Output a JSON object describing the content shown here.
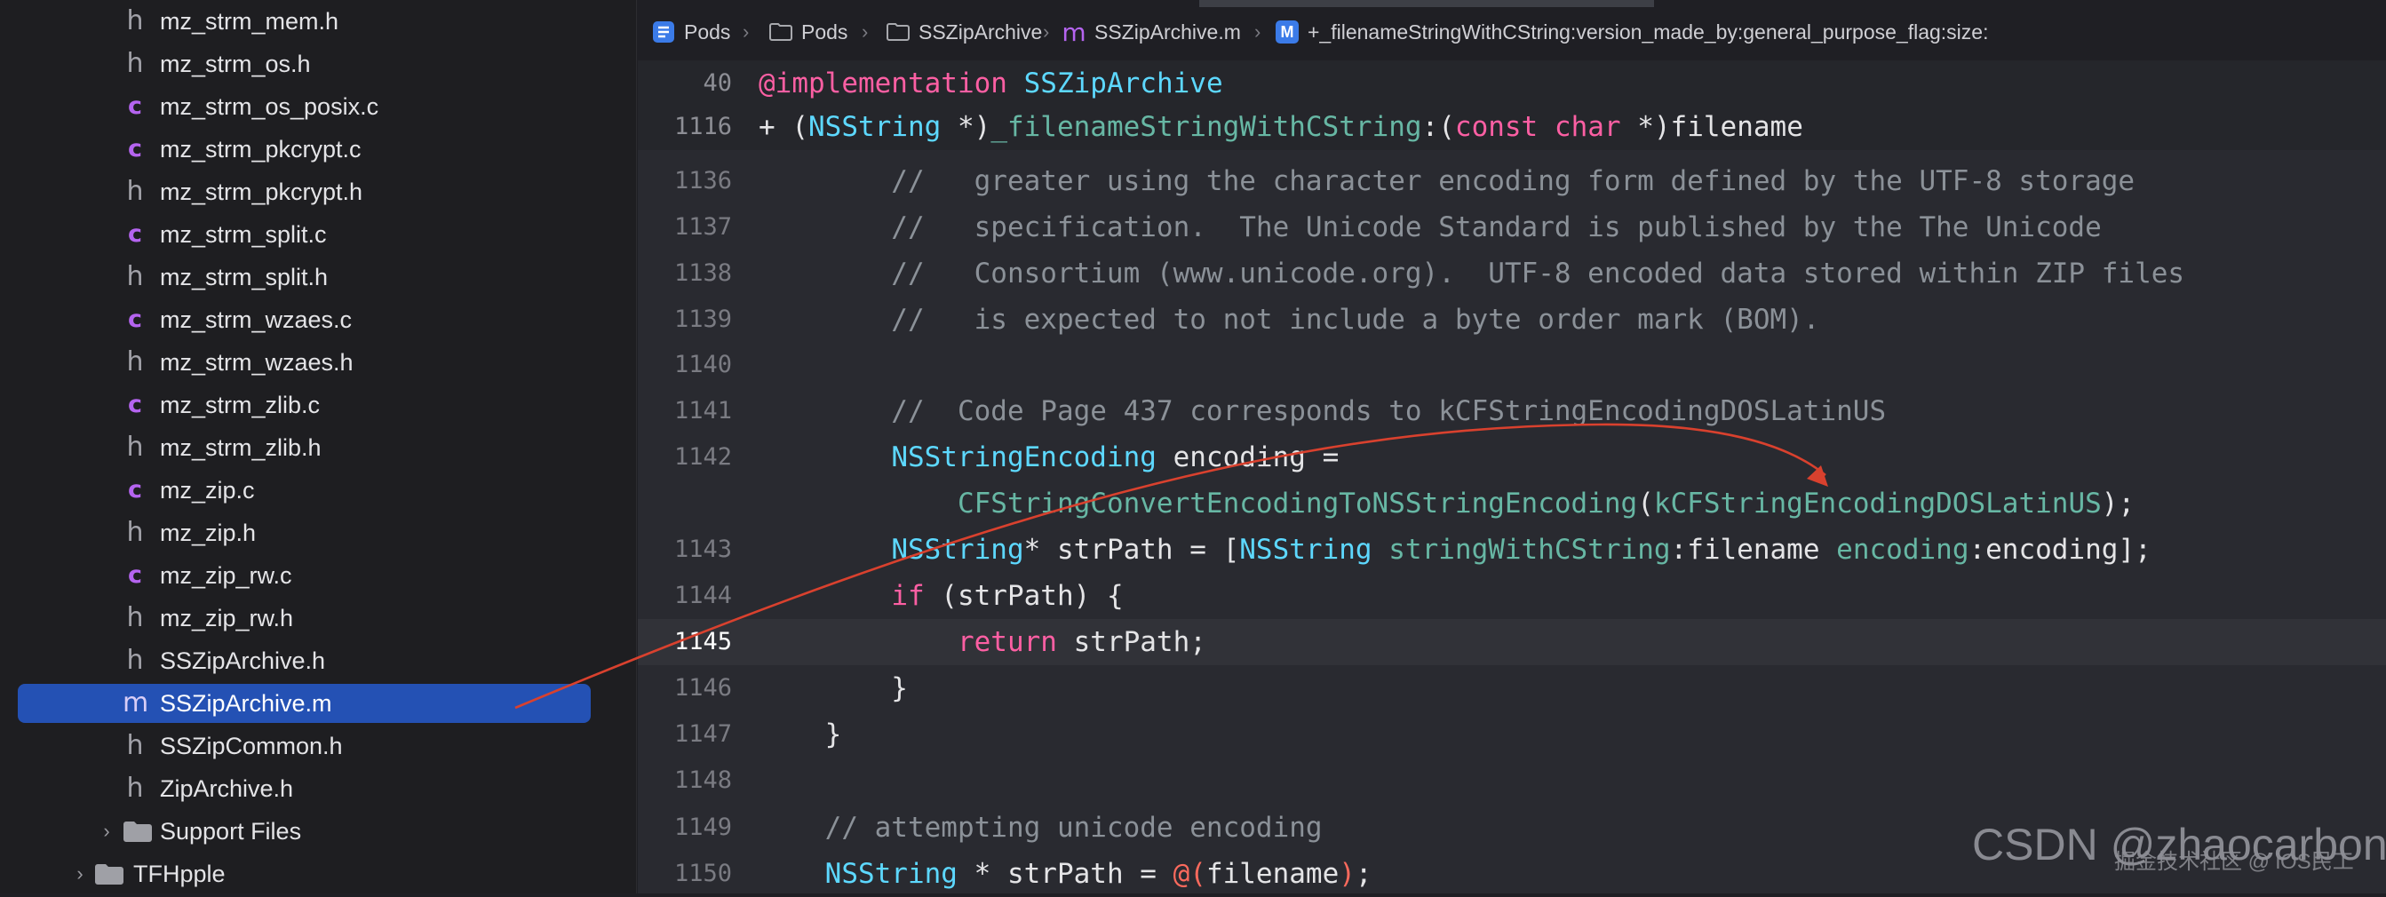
{
  "sidebar": {
    "files": [
      {
        "name": "mz_strm_mem.h",
        "type": "h"
      },
      {
        "name": "mz_strm_os.h",
        "type": "h"
      },
      {
        "name": "mz_strm_os_posix.c",
        "type": "c"
      },
      {
        "name": "mz_strm_pkcrypt.c",
        "type": "c"
      },
      {
        "name": "mz_strm_pkcrypt.h",
        "type": "h"
      },
      {
        "name": "mz_strm_split.c",
        "type": "c"
      },
      {
        "name": "mz_strm_split.h",
        "type": "h"
      },
      {
        "name": "mz_strm_wzaes.c",
        "type": "c"
      },
      {
        "name": "mz_strm_wzaes.h",
        "type": "h"
      },
      {
        "name": "mz_strm_zlib.c",
        "type": "c"
      },
      {
        "name": "mz_strm_zlib.h",
        "type": "h"
      },
      {
        "name": "mz_zip.c",
        "type": "c"
      },
      {
        "name": "mz_zip.h",
        "type": "h"
      },
      {
        "name": "mz_zip_rw.c",
        "type": "c"
      },
      {
        "name": "mz_zip_rw.h",
        "type": "h"
      },
      {
        "name": "SSZipArchive.h",
        "type": "h"
      },
      {
        "name": "SSZipArchive.m",
        "type": "m",
        "selected": true
      },
      {
        "name": "SSZipCommon.h",
        "type": "h"
      },
      {
        "name": "ZipArchive.h",
        "type": "h"
      }
    ],
    "icon_glyphs": {
      "h": "h",
      "c": "c",
      "m": "m"
    },
    "support_folder": "Support Files",
    "next_group": "TFHpple"
  },
  "breadcrumb": {
    "items": [
      "Pods",
      "Pods",
      "SSZipArchive",
      "SSZipArchive.m",
      "+_filenameStringWithCString:version_made_by:general_purpose_flag:size:"
    ],
    "method_badge": "M",
    "file_badge": "m",
    "separator": "›"
  },
  "editor": {
    "sticky_headers": [
      {
        "num": "40",
        "parts": [
          [
            "kw",
            "@implementation"
          ],
          [
            "",
            " "
          ],
          [
            "cls",
            "SSZipArchive"
          ]
        ]
      },
      {
        "num": "1116",
        "parts": [
          [
            "",
            "+ ("
          ],
          [
            "cls",
            "NSString"
          ],
          [
            "",
            " *)"
          ],
          [
            "fn",
            "_filenameStringWithCString"
          ],
          [
            "",
            ":("
          ],
          [
            "kw",
            "const"
          ],
          [
            "",
            " "
          ],
          [
            "kw",
            "char"
          ],
          [
            "",
            " *)filename"
          ]
        ]
      }
    ],
    "lines": [
      {
        "num": "1136",
        "parts": [
          [
            "cm",
            "        //   greater using the character encoding form defined by the UTF-8 storage"
          ]
        ]
      },
      {
        "num": "1137",
        "parts": [
          [
            "cm",
            "        //   specification.  The Unicode Standard is published by the The Unicode"
          ]
        ]
      },
      {
        "num": "1138",
        "parts": [
          [
            "cm",
            "        //   Consortium (www.unicode.org).  UTF-8 encoded data stored within ZIP files"
          ]
        ]
      },
      {
        "num": "1139",
        "parts": [
          [
            "cm",
            "        //   is expected to not include a byte order mark (BOM)."
          ]
        ]
      },
      {
        "num": "1140",
        "parts": []
      },
      {
        "num": "1141",
        "parts": [
          [
            "cm",
            "        //  Code Page 437 corresponds to kCFStringEncodingDOSLatinUS"
          ]
        ]
      },
      {
        "num": "1142",
        "parts": [
          [
            "",
            "        "
          ],
          [
            "cls",
            "NSStringEncoding"
          ],
          [
            "",
            " encoding ="
          ]
        ]
      },
      {
        "num": "",
        "parts": [
          [
            "",
            "            "
          ],
          [
            "fn",
            "CFStringConvertEncodingToNSStringEncoding"
          ],
          [
            "",
            "("
          ],
          [
            "fn",
            "kCFStringEncodingDOSLatinUS"
          ],
          [
            "",
            ");"
          ]
        ]
      },
      {
        "num": "1143",
        "parts": [
          [
            "",
            "        "
          ],
          [
            "cls",
            "NSString"
          ],
          [
            "",
            "* strPath = ["
          ],
          [
            "cls",
            "NSString"
          ],
          [
            "",
            " "
          ],
          [
            "fn",
            "stringWithCString"
          ],
          [
            "",
            ":filename "
          ],
          [
            "fn",
            "encoding"
          ],
          [
            "",
            ":encoding];"
          ]
        ]
      },
      {
        "num": "1144",
        "parts": [
          [
            "",
            "        "
          ],
          [
            "kw",
            "if"
          ],
          [
            "",
            " (strPath) {"
          ]
        ]
      },
      {
        "num": "1145",
        "parts": [
          [
            "",
            "            "
          ],
          [
            "kw",
            "return"
          ],
          [
            "",
            " strPath;"
          ]
        ],
        "highlight": true
      },
      {
        "num": "1146",
        "parts": [
          [
            "",
            "        }"
          ]
        ]
      },
      {
        "num": "1147",
        "parts": [
          [
            "",
            "    }"
          ]
        ]
      },
      {
        "num": "1148",
        "parts": []
      },
      {
        "num": "1149",
        "parts": [
          [
            "cm",
            "    // attempting unicode encoding"
          ]
        ]
      },
      {
        "num": "1150",
        "parts": [
          [
            "",
            "    "
          ],
          [
            "cls",
            "NSString"
          ],
          [
            "",
            " * strPath = "
          ],
          [
            "str",
            "@("
          ],
          [
            "",
            "filename"
          ],
          [
            "str",
            ")"
          ],
          [
            "",
            ";"
          ]
        ]
      }
    ]
  },
  "watermark": {
    "brand": "CSDN @zhaocarbon",
    "sub": "掘金技术社区 @ iOS民工"
  },
  "colors": {
    "arrow": "#d9412e",
    "selection": "#2451b4",
    "keyword": "#fc5fa3",
    "class": "#5dd8ff",
    "function": "#67b7a4",
    "comment": "#8b9198"
  }
}
